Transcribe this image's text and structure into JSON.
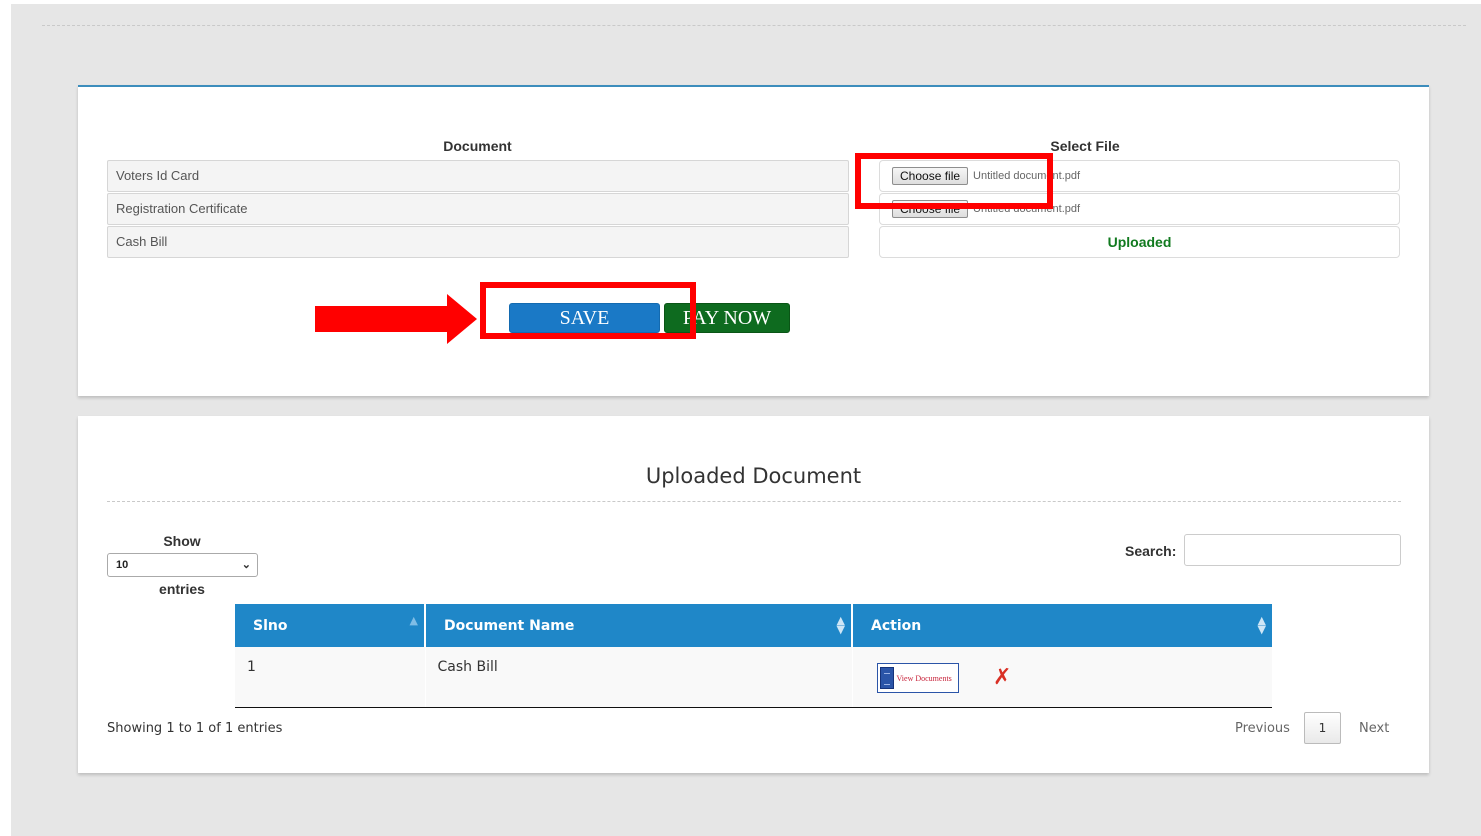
{
  "upload_form": {
    "document_header": "Document",
    "file_header": "Select File",
    "rows": [
      {
        "document": "Voters Id Card",
        "choose_label": "Choose file",
        "file_name": "Untitled document.pdf"
      },
      {
        "document": "Registration Certificate",
        "choose_label": "Choose file",
        "file_name": "Untitled document.pdf"
      },
      {
        "document": "Cash Bill",
        "status": "Uploaded"
      }
    ],
    "save_label": "SAVE",
    "pay_label": "PAY NOW"
  },
  "uploaded_section": {
    "title": "Uploaded Document",
    "show_label": "Show",
    "entries_label": "entries",
    "page_length": "10",
    "search_label": "Search:",
    "search_value": "",
    "columns": [
      "Slno",
      "Document Name",
      "Action"
    ],
    "rows": [
      {
        "slno": "1",
        "document_name": "Cash Bill",
        "view_label": "View Documents"
      }
    ],
    "info": "Showing 1 to 1 of 1 entries",
    "pagination": {
      "previous": "Previous",
      "current": "1",
      "next": "Next"
    }
  },
  "annotation_color": "#ff0000",
  "colors": {
    "accent": "#1f87c8",
    "save": "#1a79c6",
    "pay": "#0e6b1f",
    "uploaded": "#117a1f"
  }
}
